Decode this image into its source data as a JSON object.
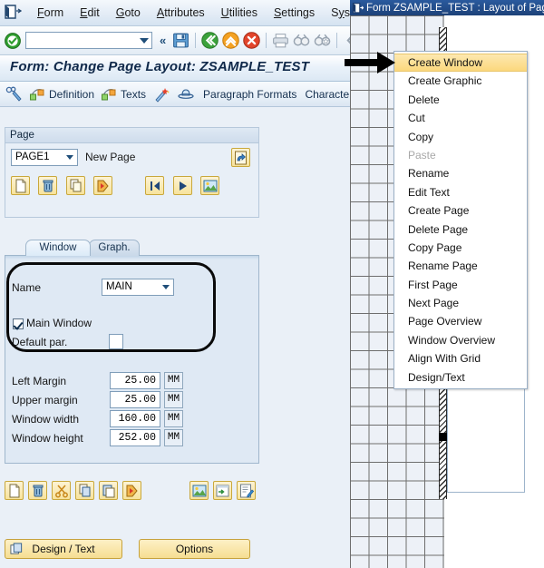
{
  "app": {
    "menu_bar": [
      {
        "label": "Form",
        "accel": "F"
      },
      {
        "label": "Edit",
        "accel": "E"
      },
      {
        "label": "Goto",
        "accel": "G"
      },
      {
        "label": "Attributes",
        "accel": "A"
      },
      {
        "label": "Utilities",
        "accel": "U"
      },
      {
        "label": "Settings",
        "accel": "S"
      },
      {
        "label": "System",
        "accel": "y"
      }
    ],
    "toolbar": {
      "command_field_value": "",
      "icons": [
        "enter-ok-icon",
        "back-green-icon",
        "exit-up-orange-icon",
        "cancel-red-icon",
        "print-icon",
        "find-icon",
        "find-next-icon",
        "first-page-icon"
      ]
    },
    "title": "Form: Change Page Layout: ZSAMPLE_TEST",
    "app_toolbar": [
      {
        "label": "",
        "icon": "binoculars-pen-icon"
      },
      {
        "label": "Definition",
        "icon": "definition-icon"
      },
      {
        "label": "Texts",
        "icon": "texts-icon"
      },
      {
        "label": "",
        "icon": "magic-wand-icon"
      },
      {
        "label": "",
        "icon": "hat-icon"
      },
      {
        "label": "Paragraph Formats",
        "icon": ""
      },
      {
        "label": "Characte",
        "icon": ""
      }
    ]
  },
  "page_group": {
    "header": "Page",
    "page_select_value": "PAGE1",
    "page_description": "New Page",
    "corner_icon": "page-refresh-icon",
    "buttons": [
      "create-page-icon",
      "delete-page-icon",
      "copy-page-icon",
      "rename-page-icon",
      "first-page-icon",
      "next-page-icon",
      "graphic-icon"
    ]
  },
  "tabs": [
    {
      "label": "Window",
      "active": true
    },
    {
      "label": "Graph.",
      "active": false
    }
  ],
  "window_tab": {
    "name_label": "Name",
    "name_value": "MAIN",
    "main_window_label": "Main Window",
    "main_window_checked": true,
    "default_par_label": "Default par.",
    "default_par_value": "",
    "fields": [
      {
        "label": "Left Margin",
        "value": "25.00",
        "unit": "MM"
      },
      {
        "label": "Upper margin",
        "value": "25.00",
        "unit": "MM"
      },
      {
        "label": "Window width",
        "value": "160.00",
        "unit": "MM"
      },
      {
        "label": "Window height",
        "value": "252.00",
        "unit": "MM"
      }
    ]
  },
  "bottom_toolbar": {
    "left_icons": [
      "new-icon",
      "delete-trash-icon",
      "cut-scissors-icon",
      "copy-icon",
      "paste-icon",
      "rename-icon"
    ],
    "right_icons": [
      "graphic-icon",
      "insert-window-icon",
      "edit-text-icon"
    ]
  },
  "bottom_buttons": [
    {
      "label": "Design / Text",
      "icon": "design-text-icon"
    },
    {
      "label": "Options",
      "icon": ""
    }
  ],
  "layout_window": {
    "title": "Form ZSAMPLE_TEST : Layout of Pag",
    "title_icon": "window-icon"
  },
  "context_menu": {
    "items": [
      {
        "label": "Create Window",
        "state": "selected"
      },
      {
        "label": "Create Graphic",
        "state": "normal"
      },
      {
        "label": "Delete",
        "state": "normal"
      },
      {
        "label": "Cut",
        "state": "normal"
      },
      {
        "label": "Copy",
        "state": "normal"
      },
      {
        "label": "Paste",
        "state": "disabled"
      },
      {
        "label": "Rename",
        "state": "normal"
      },
      {
        "label": "Edit Text",
        "state": "normal"
      },
      {
        "label": "Create Page",
        "state": "normal"
      },
      {
        "label": "Delete Page",
        "state": "normal"
      },
      {
        "label": "Copy Page",
        "state": "normal"
      },
      {
        "label": "Rename Page",
        "state": "normal"
      },
      {
        "label": "First Page",
        "state": "normal"
      },
      {
        "label": "Next Page",
        "state": "normal"
      },
      {
        "label": "Page Overview",
        "state": "normal"
      },
      {
        "label": "Window Overview",
        "state": "normal"
      },
      {
        "label": "Align With Grid",
        "state": "normal"
      },
      {
        "label": "Design/Text",
        "state": "normal"
      }
    ]
  },
  "annotation": {
    "arrow": "black-pointer-arrow",
    "points_at": "Create Window"
  },
  "colors": {
    "accent_blue": "#1d4279",
    "panel_bg": "#e8eff7",
    "highlight_yellow": "#fbd87d",
    "button_yellow": "#f6de92",
    "title_text": "#10294a"
  }
}
